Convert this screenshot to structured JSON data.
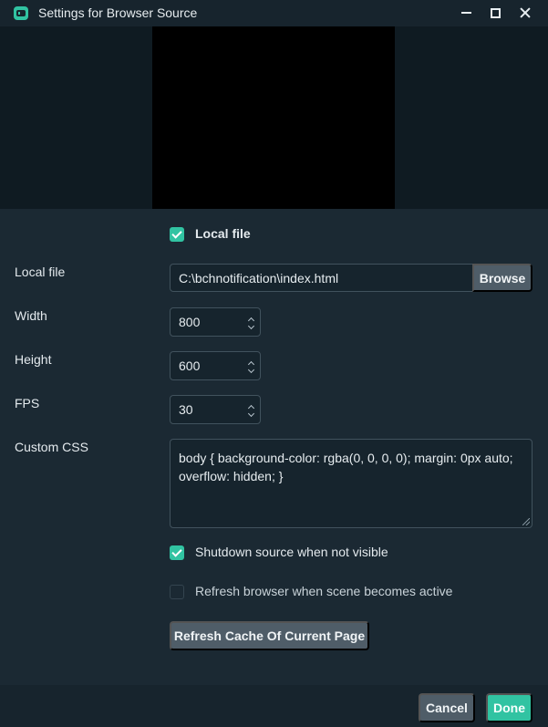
{
  "window": {
    "title": "Settings for Browser Source",
    "icon": "streamlabs-icon"
  },
  "settings": {
    "local_file_checkbox": {
      "label": "Local file",
      "checked": true
    },
    "local_file": {
      "label": "Local file",
      "value": "C:\\bchnotification\\index.html",
      "browse_label": "Browse"
    },
    "width": {
      "label": "Width",
      "value": "800"
    },
    "height": {
      "label": "Height",
      "value": "600"
    },
    "fps": {
      "label": "FPS",
      "value": "30"
    },
    "custom_css": {
      "label": "Custom CSS",
      "value": "body { background-color: rgba(0, 0, 0, 0); margin: 0px auto; overflow: hidden; }"
    },
    "shutdown_checkbox": {
      "label": "Shutdown source when not visible",
      "checked": true
    },
    "refresh_checkbox": {
      "label": "Refresh browser when scene becomes active",
      "checked": false
    },
    "refresh_cache_label": "Refresh Cache Of Current Page"
  },
  "footer": {
    "cancel_label": "Cancel",
    "done_label": "Done"
  },
  "colors": {
    "accent": "#31c3a2",
    "background": "#1b2933",
    "button": "#4f5d68"
  }
}
